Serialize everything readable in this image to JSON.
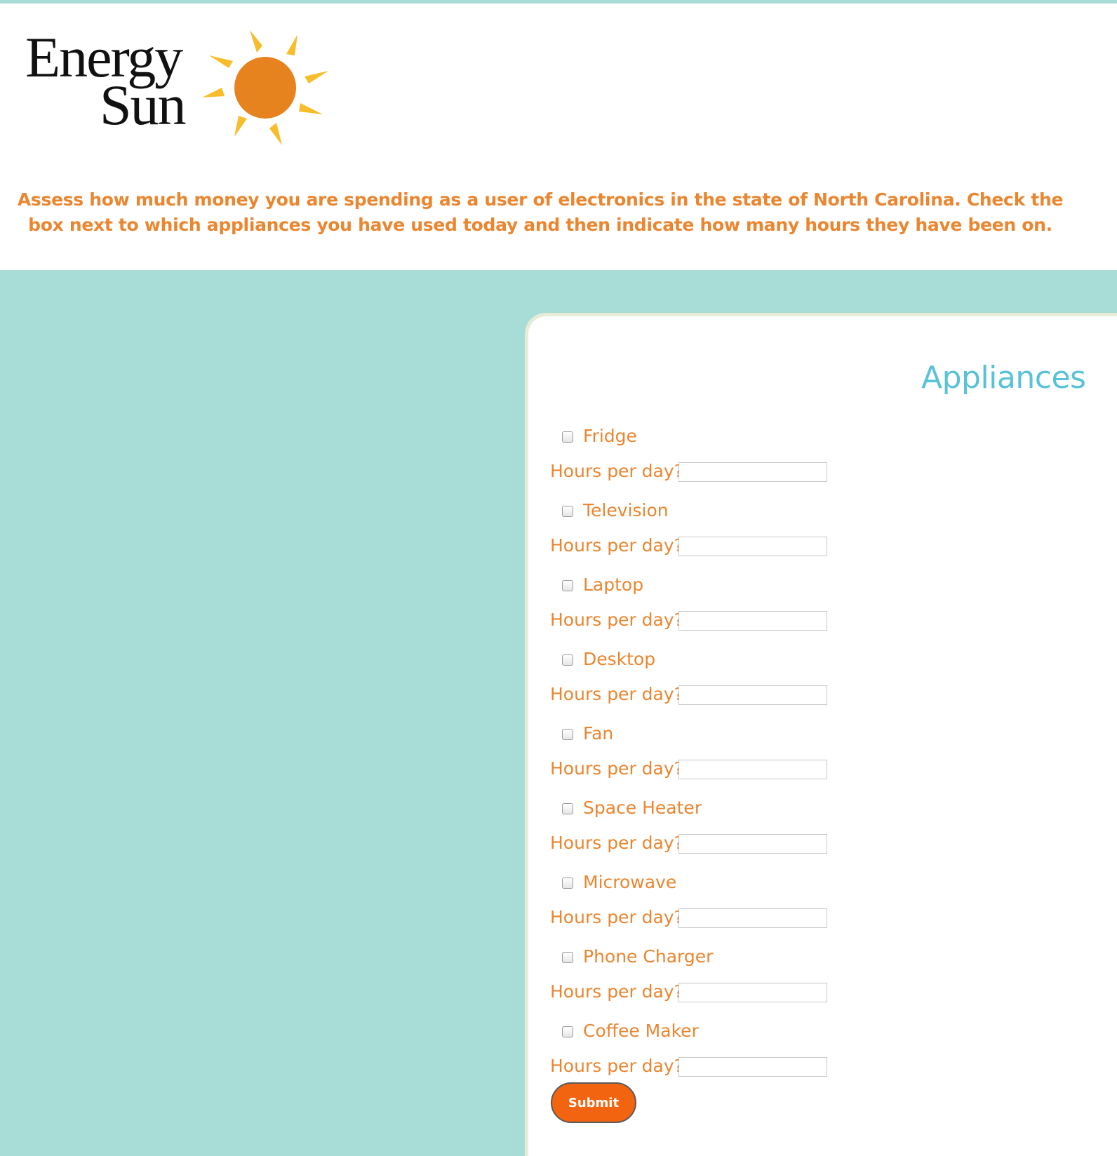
{
  "brand": {
    "logo_line1": "Energy",
    "logo_line2": "Sun",
    "sun_color": "#e6831f",
    "ray_color": "#f7bd2b"
  },
  "intro": {
    "text": "Assess how much money you are spending as a user of electronics in the state of North Carolina. Check the box next to which appliances you have used today and then indicate how many hours they have been on."
  },
  "colors": {
    "accent_orange": "#ea8630",
    "title_teal": "#5ac2d8",
    "background_teal": "#a8dcd6",
    "submit_orange": "#f2640f"
  },
  "form": {
    "title": "Appliances",
    "hours_label": "Hours per day?",
    "appliances": [
      {
        "label": "Fridge",
        "checked": false,
        "hours": ""
      },
      {
        "label": "Television",
        "checked": false,
        "hours": ""
      },
      {
        "label": "Laptop",
        "checked": false,
        "hours": ""
      },
      {
        "label": "Desktop",
        "checked": false,
        "hours": ""
      },
      {
        "label": "Fan",
        "checked": false,
        "hours": ""
      },
      {
        "label": "Space Heater",
        "checked": false,
        "hours": ""
      },
      {
        "label": "Microwave",
        "checked": false,
        "hours": ""
      },
      {
        "label": "Phone Charger",
        "checked": false,
        "hours": ""
      },
      {
        "label": "Coffee Maker",
        "checked": false,
        "hours": ""
      }
    ],
    "submit_label": "Submit"
  }
}
